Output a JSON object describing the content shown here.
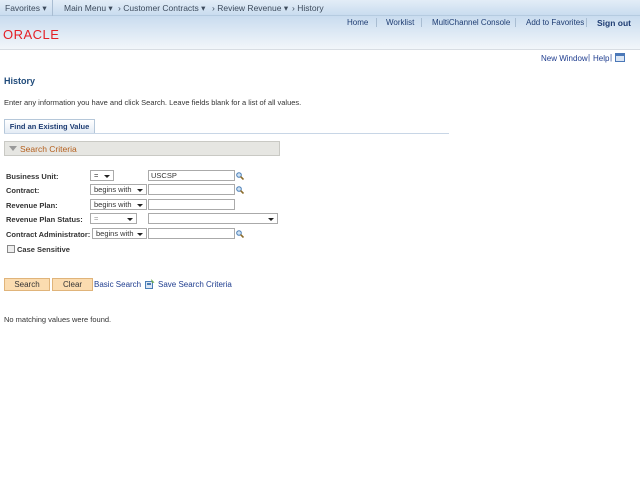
{
  "nav": {
    "favorites": "Favorites",
    "main_menu": "Main Menu",
    "breadcrumbs": [
      "Customer Contracts",
      "Review Revenue",
      "History"
    ]
  },
  "header": {
    "links": [
      "Home",
      "Worklist",
      "MultiChannel Console",
      "Add to Favorites"
    ],
    "signout": "Sign out",
    "logo": "ORACLE"
  },
  "util": {
    "new_window": "New Window",
    "help": "Help"
  },
  "page": {
    "title": "History",
    "instructions": "Enter any information you have and click Search. Leave fields blank for a list of all values.",
    "tab": "Find an Existing Value",
    "section": "Search Criteria"
  },
  "fields": [
    {
      "label": "Business Unit:",
      "operator": "=",
      "value": "USCSP",
      "lookup": true
    },
    {
      "label": "Contract:",
      "operator": "begins with",
      "value": "",
      "lookup": true
    },
    {
      "label": "Revenue Plan:",
      "operator": "begins with",
      "value": "",
      "lookup": false
    },
    {
      "label": "Revenue Plan Status:",
      "operator": "=",
      "value": "",
      "lookup": false
    },
    {
      "label": "Contract Administrator:",
      "operator": "begins with",
      "value": "",
      "lookup": true
    }
  ],
  "case_sensitive": {
    "label": "Case Sensitive",
    "checked": false
  },
  "actions": {
    "search": "Search",
    "clear": "Clear",
    "basic_search": "Basic Search",
    "save_criteria": "Save Search Criteria"
  },
  "result_message": "No matching values were found.",
  "colors": {
    "logo": "#e41f26",
    "link": "#1f3d8f",
    "button": "#fbdcb0",
    "section_title": "#b45f1c"
  }
}
